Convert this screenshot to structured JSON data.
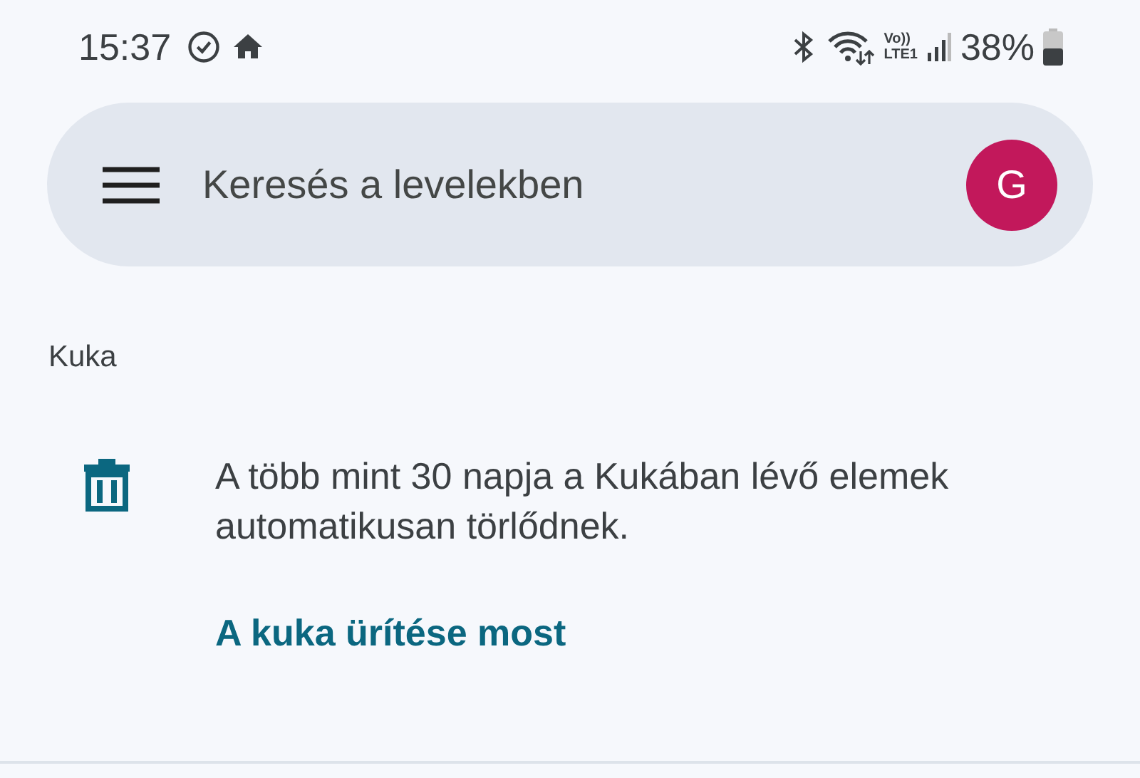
{
  "status_bar": {
    "time": "15:37",
    "network_top": "Vo))",
    "network_bottom": "LTE1",
    "battery": "38%"
  },
  "search": {
    "placeholder": "Keresés a levelekben",
    "avatar": "G"
  },
  "folder": {
    "title": "Kuka"
  },
  "notice": {
    "text": "A több mint 30 napja a Kukában lévő elemek automatikusan törlődnek.",
    "action": "A kuka ürítése most"
  }
}
